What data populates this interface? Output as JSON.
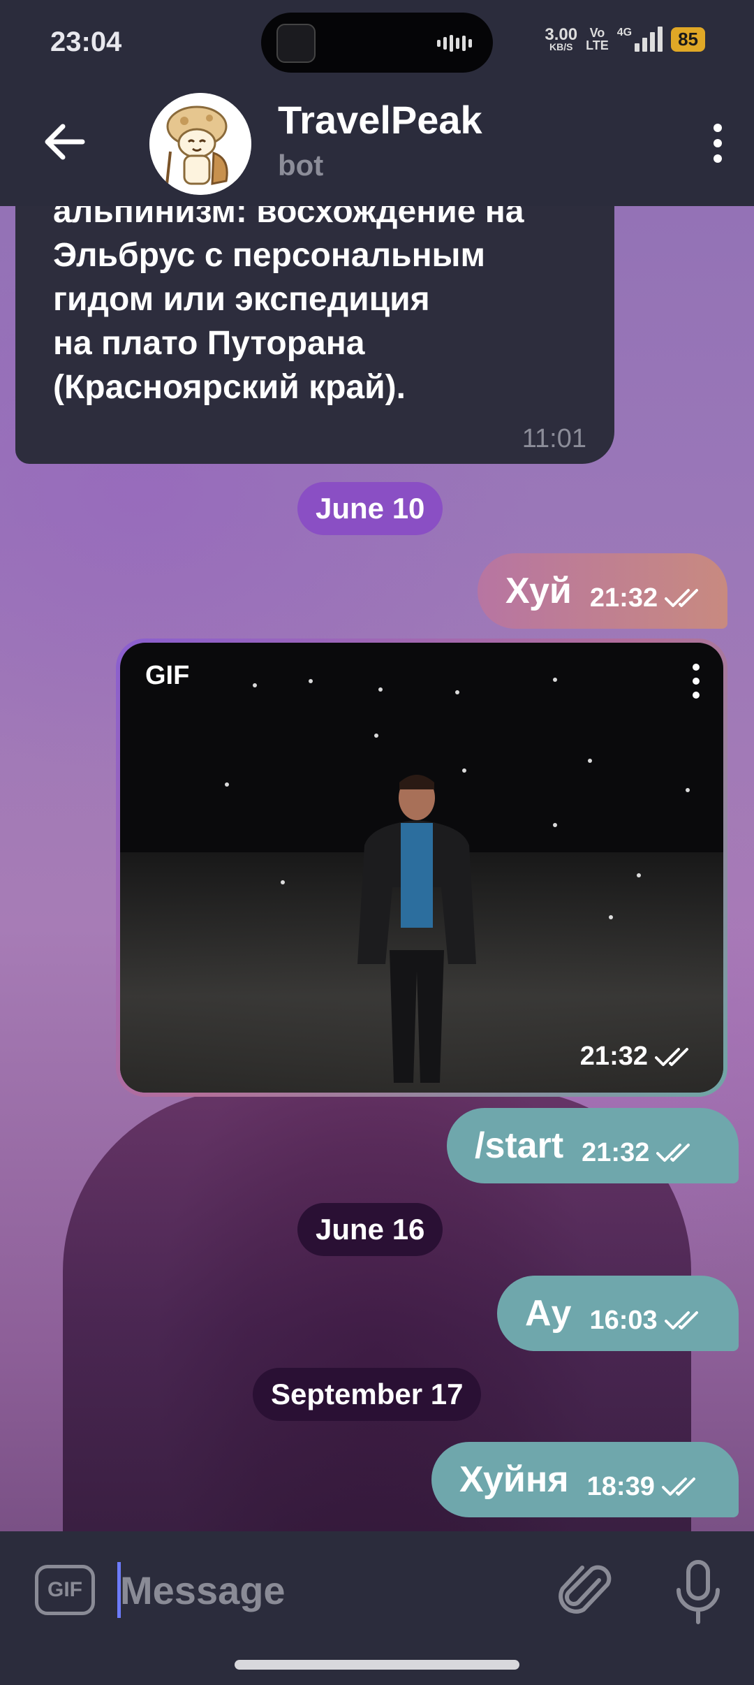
{
  "status_bar": {
    "time": "23:04",
    "net_speed": "3.00",
    "net_speed_unit": "KB/S",
    "volte_top": "Vo",
    "volte_bottom": "LTE",
    "network": "4G",
    "battery": "85"
  },
  "header": {
    "title": "TravelPeak",
    "subtitle": "bot"
  },
  "messages": {
    "incoming": {
      "text": "точно понравится элитный\nальпинизм: восхождение на\nЭльбрус с персональным\nгидом или экспедиция\nна плато Путорана\n(Красноярский край).",
      "time": "11:01"
    },
    "date_june_10": "June 10",
    "out_1": {
      "text": "Хуй",
      "time": "21:32"
    },
    "gif": {
      "label": "GIF",
      "time": "21:32"
    },
    "out_2": {
      "text": "/start",
      "time": "21:32"
    },
    "date_june_16": "June 16",
    "out_3": {
      "text": "Ау",
      "time": "16:03"
    },
    "date_sep_17": "September 17",
    "out_4": {
      "text": "Хуйня",
      "time": "18:39"
    }
  },
  "input_bar": {
    "gif_label": "GIF",
    "placeholder": "Message"
  },
  "colors": {
    "bar_background": "#2b2c3c",
    "incoming_bubble": "#2d2d3d",
    "outgoing_pink": "#b775a2",
    "outgoing_teal": "#6fa7ac",
    "date_pill_purple": "#8a4fc4",
    "date_pill_dark": "#2a1034",
    "battery": "#e0a826"
  }
}
